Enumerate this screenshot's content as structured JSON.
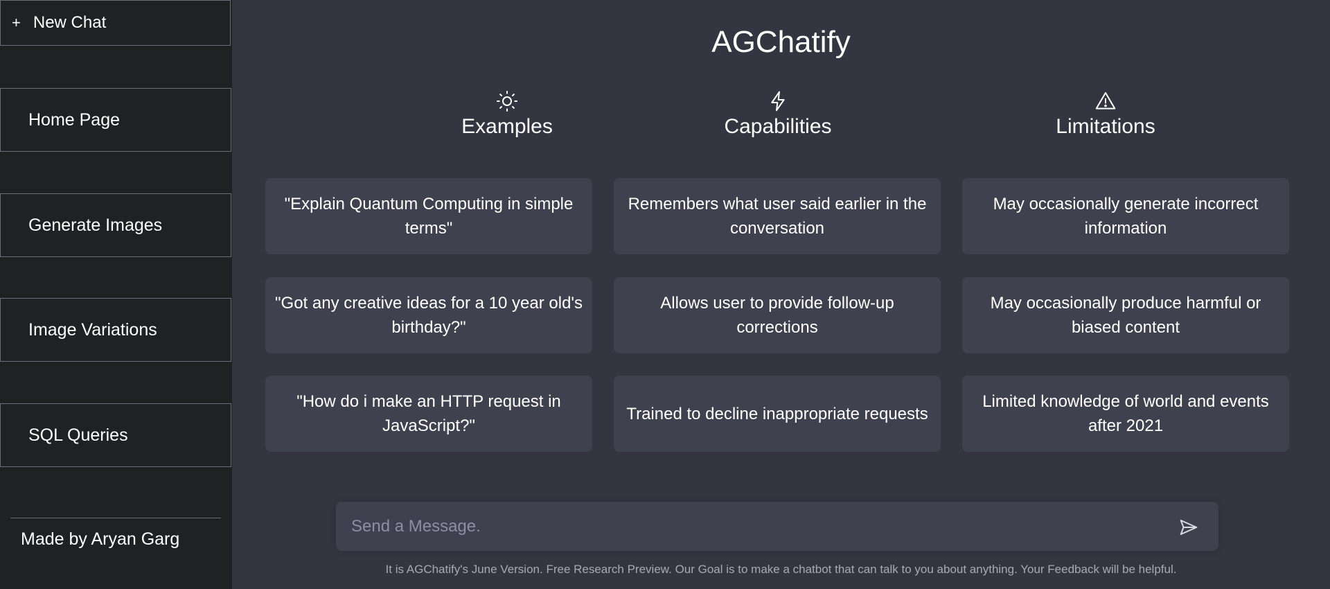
{
  "sidebar": {
    "new_chat": {
      "icon": "plus-icon",
      "label": "New Chat"
    },
    "items": [
      {
        "label": "Home Page"
      },
      {
        "label": "Generate Images"
      },
      {
        "label": "Image Variations"
      },
      {
        "label": "SQL Queries"
      }
    ],
    "footer": "Made by Aryan Garg"
  },
  "main": {
    "title": "AGChatify",
    "columns": [
      {
        "icon": "sun-icon",
        "heading": "Examples",
        "cards": [
          "\"Explain Quantum Computing in simple terms\"",
          "\"Got any creative ideas for a 10 year old's birthday?\"",
          "\"How do i make an HTTP request in JavaScript?\""
        ]
      },
      {
        "icon": "lightning-icon",
        "heading": "Capabilities",
        "cards": [
          "Remembers what user said earlier in the conversation",
          "Allows user to provide follow-up corrections",
          "Trained to decline inappropriate requests"
        ]
      },
      {
        "icon": "warning-icon",
        "heading": "Limitations",
        "cards": [
          "May occasionally generate incorrect information",
          "May occasionally produce harmful or biased content",
          "Limited knowledge of world and events after 2021"
        ]
      }
    ],
    "input": {
      "placeholder": "Send a Message.",
      "value": "",
      "send_icon": "send-icon"
    },
    "footer": "It is AGChatify's June Version. Free Research Preview. Our Goal is to make a chatbot that can talk to you about anything. Your Feedback will be helpful."
  },
  "colors": {
    "sidebar_bg": "#202123",
    "main_bg": "#343541",
    "card_bg": "#40414f",
    "border": "#6b6c75",
    "text": "#ffffff",
    "muted_text": "#a9a9b3"
  }
}
